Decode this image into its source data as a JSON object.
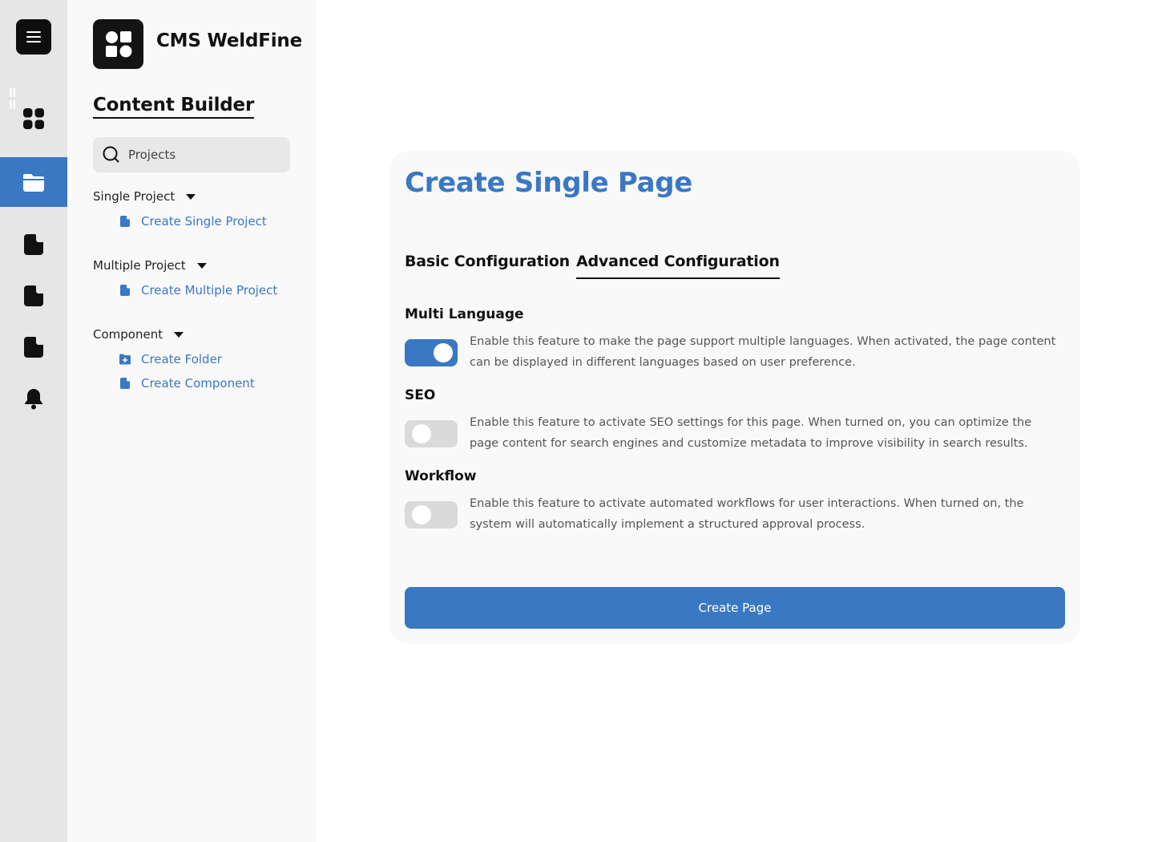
{
  "brand": {
    "name": "CMS WeldFine"
  },
  "sidebar": {
    "section_title": "Content Builder",
    "search_placeholder": "Projects",
    "groups": [
      {
        "label": "Single Project",
        "items": [
          {
            "label": "Create Single Project",
            "icon": "file-icon"
          }
        ]
      },
      {
        "label": "Multiple Project",
        "items": [
          {
            "label": "Create Multiple Project",
            "icon": "file-icon"
          }
        ]
      },
      {
        "label": "Component",
        "items": [
          {
            "label": "Create Folder",
            "icon": "folder-plus-icon"
          },
          {
            "label": "Create Component",
            "icon": "file-icon"
          }
        ]
      }
    ]
  },
  "rail": {
    "items": [
      "menu-icon",
      "dashboard-icon",
      "folder-icon",
      "file-icon",
      "file-icon",
      "file-icon",
      "bell-icon"
    ],
    "active": "folder-icon"
  },
  "main": {
    "title": "Create Single Page",
    "tabs": [
      {
        "label": "Basic Configuration",
        "active": false
      },
      {
        "label": "Advanced Configuration",
        "active": true
      }
    ],
    "features": [
      {
        "label": "Multi Language",
        "enabled": true,
        "description": "Enable this feature to make the page support multiple languages. When activated, the page content can be displayed in different languages based on user preference."
      },
      {
        "label": "SEO",
        "enabled": false,
        "description": "Enable this feature to activate SEO settings for this page. When turned on, you can optimize the page content for search engines and customize metadata to improve visibility in search results."
      },
      {
        "label": "Workflow",
        "enabled": false,
        "description": "Enable this feature to activate automated workflows for user interactions. When turned on, the system will automatically implement a structured approval process."
      }
    ],
    "submit_label": "Create Page"
  },
  "colors": {
    "accent": "#3a78c3",
    "rail_bg": "#e6e6e6",
    "sidebar_bg": "#f9f9f9",
    "toggle_off": "#dadada"
  }
}
